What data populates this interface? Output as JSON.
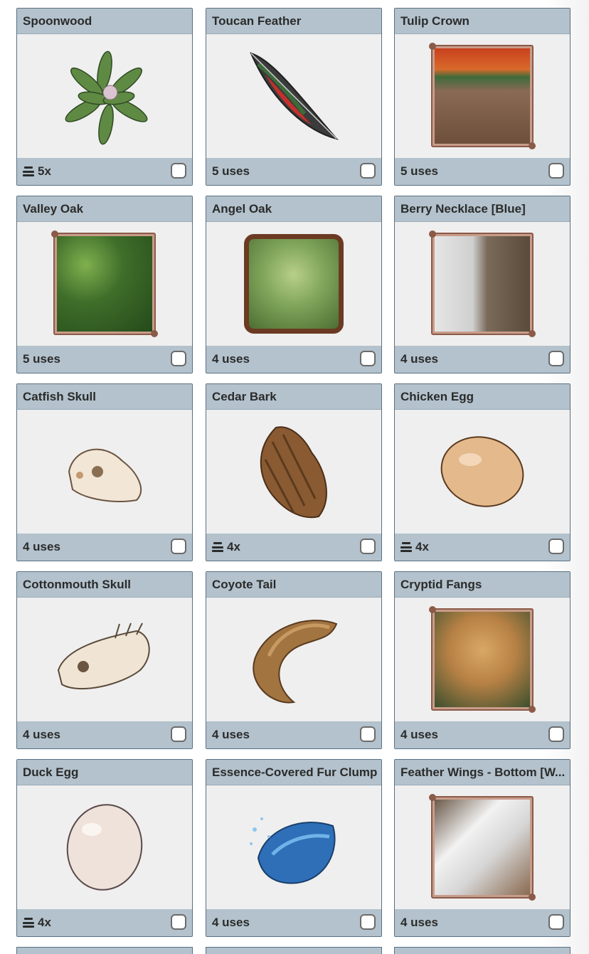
{
  "items": [
    {
      "name": "Spoonwood",
      "footer": "5x",
      "stack": true,
      "icon": "spoonwood-leaves-icon"
    },
    {
      "name": "Toucan Feather",
      "footer": "5 uses",
      "stack": false,
      "icon": "feather-icon"
    },
    {
      "name": "Tulip Crown",
      "footer": "5 uses",
      "stack": false,
      "icon": "tulip-crown-portrait-icon"
    },
    {
      "name": "Valley Oak",
      "footer": "5 uses",
      "stack": false,
      "icon": "valley-oak-foliage-icon"
    },
    {
      "name": "Angel Oak",
      "footer": "4 uses",
      "stack": false,
      "icon": "angel-oak-frame-icon"
    },
    {
      "name": "Berry Necklace [Blue]",
      "footer": "4 uses",
      "stack": false,
      "icon": "berry-necklace-portrait-icon"
    },
    {
      "name": "Catfish Skull",
      "footer": "4 uses",
      "stack": false,
      "icon": "catfish-skull-icon"
    },
    {
      "name": "Cedar Bark",
      "footer": "4x",
      "stack": true,
      "icon": "cedar-bark-icon"
    },
    {
      "name": "Chicken Egg",
      "footer": "4x",
      "stack": true,
      "icon": "chicken-egg-icon"
    },
    {
      "name": "Cottonmouth Skull",
      "footer": "4 uses",
      "stack": false,
      "icon": "snake-skull-icon"
    },
    {
      "name": "Coyote Tail",
      "footer": "4 uses",
      "stack": false,
      "icon": "coyote-tail-icon"
    },
    {
      "name": "Cryptid Fangs",
      "footer": "4 uses",
      "stack": false,
      "icon": "cryptid-fangs-portrait-icon"
    },
    {
      "name": "Duck Egg",
      "footer": "4x",
      "stack": true,
      "icon": "duck-egg-icon"
    },
    {
      "name": "Essence-Covered Fur Clump",
      "footer": "4 uses",
      "stack": false,
      "icon": "blue-fur-clump-icon"
    },
    {
      "name": "Feather Wings - Bottom [W...",
      "footer": "4 uses",
      "stack": false,
      "icon": "feather-wings-portrait-icon"
    }
  ]
}
